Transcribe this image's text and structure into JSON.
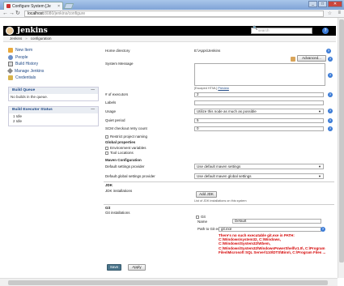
{
  "browser": {
    "tab_title": "Configure System [Je",
    "tab_close": "×",
    "url_host": "localhost",
    "url_path": ":8080/jenkins/configure",
    "min": "_",
    "max": "□",
    "close": "✕"
  },
  "header": {
    "title": "Jenkins",
    "search_placeholder": "search",
    "help": "?"
  },
  "breadcrumb": [
    "Jenkins",
    "configuration"
  ],
  "sidebar": {
    "items": [
      {
        "label": "New Item",
        "icon": "new-item-icon"
      },
      {
        "label": "People",
        "icon": "people-icon"
      },
      {
        "label": "Build History",
        "icon": "build-history-icon"
      },
      {
        "label": "Manage Jenkins",
        "icon": "manage-jenkins-icon"
      },
      {
        "label": "Credentials",
        "icon": "credentials-icon"
      }
    ],
    "build_queue": {
      "title": "Build Queue",
      "collapse": "—",
      "empty": "No builds in the queue."
    },
    "executor_status": {
      "title": "Build Executor Status",
      "collapse": "—",
      "executors": [
        "1  Idle",
        "2  Idle"
      ]
    }
  },
  "form": {
    "home_directory_label": "Home directory",
    "home_directory_value": "E:\\Apps\\Jenkins",
    "system_message_label": "System Message",
    "advanced_button": "Advanced...",
    "escaped_html": "[Escaped HTML]",
    "preview": "Preview",
    "executors_label": "# of executors",
    "executors_value": "2",
    "labels_label": "Labels",
    "labels_value": "",
    "usage_label": "Usage",
    "usage_value": "Utilize this node as much as possible",
    "quiet_period_label": "Quiet period",
    "quiet_period_value": "5",
    "scm_retry_label": "SCM checkout retry count",
    "scm_retry_value": "0",
    "restrict_label": "Restrict project naming",
    "global_properties": "Global properties",
    "env_vars": "Environment variables",
    "tool_locations": "Tool Locations",
    "maven_config": "Maven Configuration",
    "default_settings_label": "Default settings provider",
    "default_settings_value": "Use default maven settings",
    "default_global_label": "Default global settings provider",
    "default_global_value": "Use default maven global settings",
    "jdk_section": "JDK",
    "jdk_installations": "JDK installations",
    "add_jdk": "Add JDK",
    "jdk_hint": "List of JDK installations on this system",
    "git_section": "Git",
    "git_installations": "Git installations",
    "git_label": "Git",
    "name_label": "Name",
    "name_value": "Default",
    "path_label": "Path to Git executable",
    "path_value": "git.exe",
    "error_text": "There's no such executable git.exe in PATH: C:\\Windows\\system32, C:\\Windows, C:\\Windows\\System32\\Wbem, C:\\Windows\\System32\\WindowsPowerShell\\v1.0\\, C:\\Program Files\\Microsoft SQL Server\\110\\DTS\\Binn\\, C:\\Program Files ...",
    "save_button": "Save",
    "apply_button": "Apply"
  },
  "colors": {
    "error": "#d40000",
    "link": "#204a87",
    "header_bg": "#000000",
    "save_bg": "#4b758b"
  }
}
